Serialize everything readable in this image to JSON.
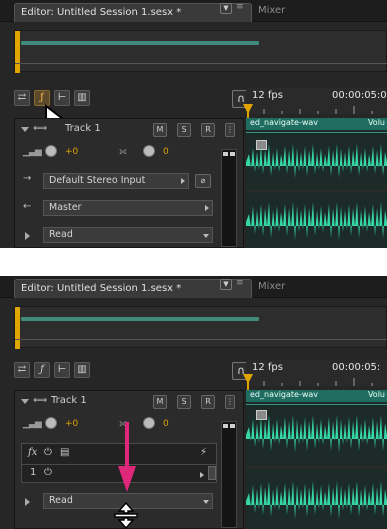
{
  "top": {
    "tab_title": "Editor: Untitled Session 1.sesx *",
    "tab_menu": "▼",
    "tab_separator": "≡",
    "tab_mixer": "Mixer",
    "ruler_fps": "12 fps",
    "ruler_time": "00:00:05:0",
    "track": {
      "name": "Track 1",
      "mute": "M",
      "solo": "S",
      "record": "R",
      "volume_value": "+0",
      "pan_value": "0",
      "input_field": "Default Stereo Input",
      "output_field": "Master",
      "automation_field": "Read"
    },
    "clip": {
      "name": "ed_navigate-wav",
      "volume_label": "Volu"
    }
  },
  "bottom": {
    "tab_title": "Editor: Untitled Session 1.sesx *",
    "tab_menu": "▼",
    "tab_separator": "≡",
    "tab_mixer": "Mixer",
    "ruler_fps": "12 fps",
    "ruler_time": "00:00:05:",
    "track": {
      "name": "Track 1",
      "mute": "M",
      "solo": "S",
      "record": "R",
      "volume_value": "+0",
      "pan_value": "0",
      "effects_fx": "fx",
      "rack_row_number": "1",
      "automation_field": "Read"
    },
    "clip": {
      "name": "ed_navigate-wav",
      "volume_label": "Volu"
    }
  },
  "icons": {
    "toolbar_top": [
      "io-icon",
      "fx-icon",
      "sends-icon",
      "eq-icon"
    ],
    "toolbar_bottom": [
      "io-icon",
      "fx-icon",
      "sends-icon",
      "eq-icon"
    ]
  },
  "colors": {
    "playhead": "#e0a500",
    "clip_header": "#1f6d60",
    "waveform": "#36d6a6",
    "knob_value": "#e0a500",
    "annotation_arrow": "#e0287a"
  }
}
